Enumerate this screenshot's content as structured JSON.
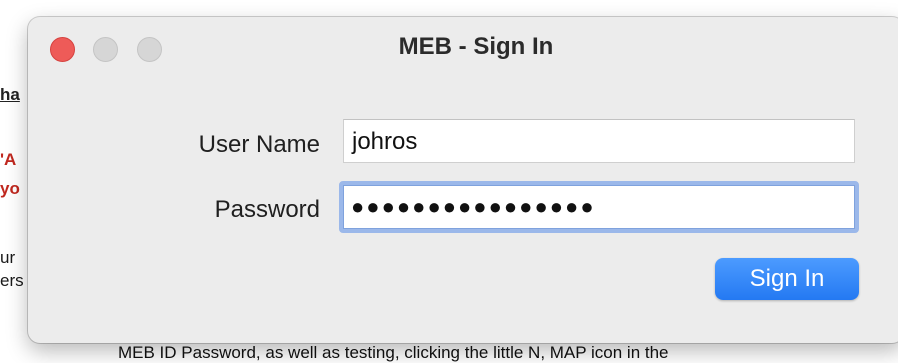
{
  "background_page": {
    "fragments": [
      "ha",
      "'A",
      "yo",
      "ur",
      "ers"
    ],
    "bottom_text": "MEB ID Password, as well as testing, clicking the little N, MAP icon in the"
  },
  "dialog": {
    "title": "MEB - Sign In",
    "username_label": "User Name",
    "username_value": "johros",
    "password_label": "Password",
    "password_value": "●●●●●●●●●●●●●●●●",
    "signin_label": "Sign In",
    "buttons": {
      "close": "close-button",
      "minimize": "minimize-button",
      "maximize": "zoom-button"
    }
  },
  "colors": {
    "close": "#ee5b58",
    "accent": "#2479f2",
    "focus_ring": "#9bb8ea",
    "window_bg": "#ececec"
  }
}
